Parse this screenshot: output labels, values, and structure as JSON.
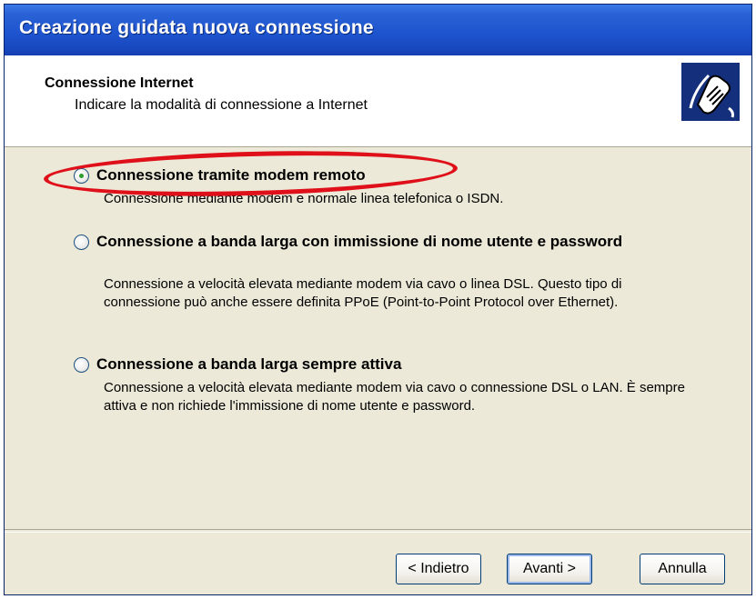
{
  "window": {
    "title": "Creazione guidata nuova connessione"
  },
  "header": {
    "title": "Connessione Internet",
    "subtitle": "Indicare la modalità di connessione a Internet",
    "icon": "network-connection-icon"
  },
  "options": [
    {
      "label": "Connessione tramite modem remoto",
      "description": "Connessione mediante modem e normale linea telefonica o ISDN.",
      "selected": true
    },
    {
      "label": "Connessione a banda larga con immissione di nome utente e password",
      "description": "Connessione a velocità elevata mediante modem via cavo o linea DSL. Questo tipo di connessione può anche essere definita PPoE (Point-to-Point Protocol over Ethernet).",
      "selected": false
    },
    {
      "label": "Connessione a banda larga sempre attiva",
      "description": "Connessione a velocità elevata mediante modem via cavo o connessione DSL o LAN. È sempre attiva e non richiede l'immissione di nome utente e password.",
      "selected": false
    }
  ],
  "buttons": {
    "back": "< Indietro",
    "next": "Avanti >",
    "cancel": "Annulla"
  },
  "colors": {
    "titlebar": "#1e55cf",
    "highlight_ring": "#e0101a",
    "radio_selected_dot": "#2d9d2d"
  }
}
